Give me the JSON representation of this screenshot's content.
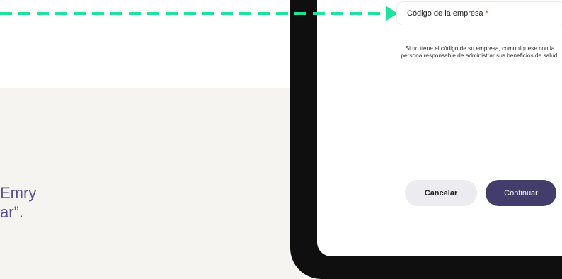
{
  "background_text": {
    "line1": "Emry",
    "line2": "ar”."
  },
  "form": {
    "company_code_label": "Código de la empresa",
    "required_mark": "*",
    "help_text": "Si no tiene el código de su empresa, comuníquese con la persona responsable de administrar sus beneficios de salud."
  },
  "buttons": {
    "cancel_label": "Cancelar",
    "continue_label": "Continuar"
  },
  "colors": {
    "accent_arrow": "#1de39d",
    "primary_button": "#433d6c",
    "text_purple": "#5a4f92",
    "panel_beige": "#f6f4f0"
  }
}
